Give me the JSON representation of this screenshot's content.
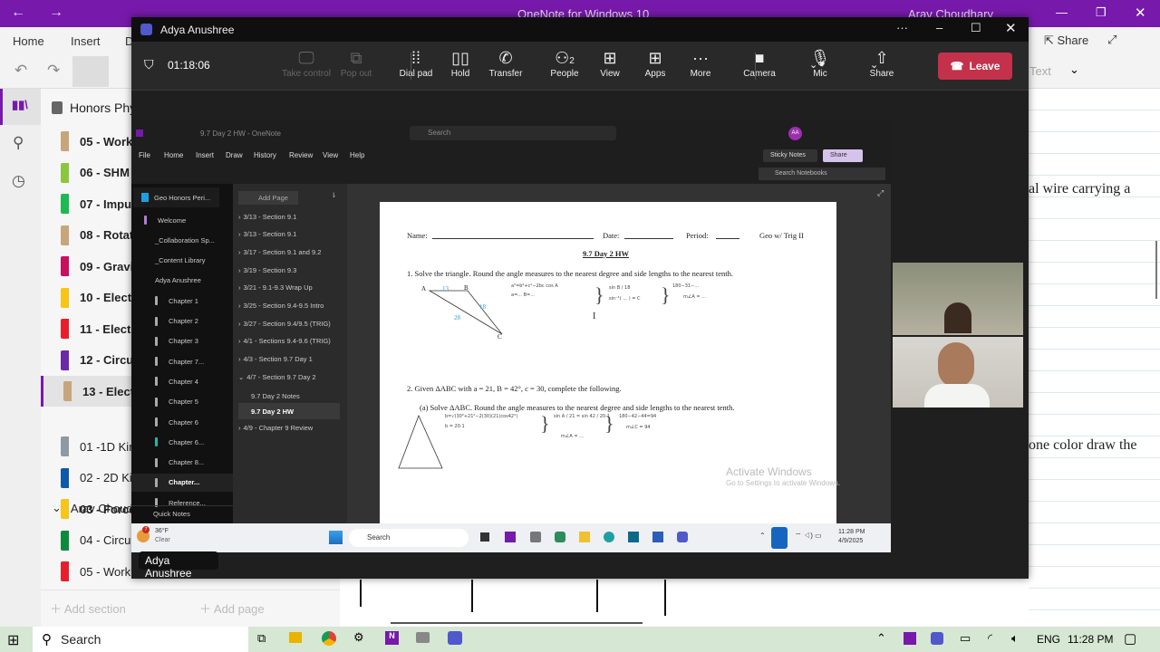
{
  "onenote": {
    "title": "OneNote for Windows 10",
    "user": "Arav Choudhary",
    "tabs": [
      "Home",
      "Insert",
      "D"
    ],
    "share_label": "Share",
    "text_label": "Text",
    "notebook": "Honors Phys",
    "sections": [
      {
        "label": "05 - Work",
        "color": "#c8a57a"
      },
      {
        "label": "06 - SHM",
        "color": "#8cc63f"
      },
      {
        "label": "07 - Impul",
        "color": "#1db954"
      },
      {
        "label": "08 - Rotati",
        "color": "#c8a57a"
      },
      {
        "label": "09 - Gravit",
        "color": "#c8105e"
      },
      {
        "label": "10 - Electri",
        "color": "#f5c518"
      },
      {
        "label": "11 - Electri",
        "color": "#e81e2c"
      },
      {
        "label": "12 - Circuit",
        "color": "#6b2aa8"
      },
      {
        "label": "13 - Electro",
        "color": "#c8a57a"
      }
    ],
    "group": "Arav Choud",
    "group_sections": [
      {
        "label": "01 -1D Kin",
        "color": "#8e9aa3"
      },
      {
        "label": "02 - 2D Kin",
        "color": "#0f5aa8"
      },
      {
        "label": "03 - Force",
        "color": "#f5c518"
      },
      {
        "label": "04 - Circula",
        "color": "#0e8a3e"
      },
      {
        "label": "05 - Work",
        "color": "#e81e2c"
      }
    ],
    "add_section": "Add section",
    "add_page": "Add page",
    "note_lines": [
      "al wire carrying a",
      "one color draw the"
    ]
  },
  "teams": {
    "title": "Adya Anushree",
    "timer": "01:18:06",
    "buttons": [
      {
        "label": "Take control",
        "icon": "monitor-cursor"
      },
      {
        "label": "Pop out",
        "icon": "popout"
      },
      {
        "label": "Dial pad",
        "icon": "dialpad"
      },
      {
        "label": "Hold",
        "icon": "pause"
      },
      {
        "label": "Transfer",
        "icon": "phone-transfer"
      },
      {
        "label": "People",
        "icon": "people",
        "count": "2"
      },
      {
        "label": "View",
        "icon": "grid"
      },
      {
        "label": "Apps",
        "icon": "plus-box"
      },
      {
        "label": "More",
        "icon": "ellipsis"
      },
      {
        "label": "Camera",
        "icon": "camera"
      },
      {
        "label": "Mic",
        "icon": "mic"
      },
      {
        "label": "Share",
        "icon": "share-up"
      }
    ],
    "leave_label": "Leave",
    "leave_color": "#c4314b",
    "presenter_label": "Adya Anushree"
  },
  "shared": {
    "title": "9.7 Day 2 HW  -  OneNote",
    "search": "Search",
    "avatar": "AA",
    "menu": [
      "File",
      "Home",
      "Insert",
      "Draw",
      "History",
      "Review",
      "View",
      "Help"
    ],
    "sticky": "Sticky Notes",
    "share": "Share",
    "search_notebooks": "Search Notebooks",
    "notebook": "Geo Honors Peri...",
    "sections": [
      "Welcome",
      "_Collaboration Sp...",
      "_Content Library",
      "Adya Anushree",
      "Chapter 1",
      "Chapter 2",
      "Chapter 3",
      "Chapter 7...",
      "Chapter 4",
      "Chapter 5",
      "Chapter 6",
      "Chapter 6...",
      "Chapter 8...",
      "Chapter...",
      "Reference..."
    ],
    "quick_notes": "Quick Notes",
    "add_page": "Add Page",
    "pages": [
      "3/13 - Section 9.1",
      "3/13 - Section 9.1",
      "3/17 - Section 9.1 and 9.2",
      "3/19 - Section 9.3",
      "3/21 - 9.1-9.3 Wrap Up",
      "3/25 - Section 9.4-9.5 Intro",
      "3/27 - Section 9.4/9.5 (TRIG)",
      "4/1 - Sections 9.4-9.6 (TRIG)",
      "4/3 - Section 9.7 Day 1",
      "4/7 - Section 9.7 Day 2"
    ],
    "subpages": [
      "9.7 Day 2 Notes",
      "9.7 Day 2 HW"
    ],
    "last_page": "4/9 - Chapter 9 Review",
    "doc": {
      "name": "Name:",
      "date": "Date:",
      "period": "Period:",
      "course": "Geo w/ Trig II",
      "title": "9.7 Day 2 HW",
      "q1": "1.   Solve the triangle. Round the angle measures to the nearest degree and side lengths to the nearest tenth.",
      "q1_labels": {
        "a": "A",
        "b": "B",
        "c": "C",
        "ab": "13",
        "bc": "18",
        "ac": "28"
      },
      "q2": "2.   Given ΔABC with a = 21, B = 42°, c = 30, complete the following.",
      "q2a": "(a)  Solve ΔABC. Round the angle measures to the nearest degree and side lengths to the nearest tenth."
    },
    "activate_title": "Activate Windows",
    "activate_sub": "Go to Settings to activate Windows.",
    "weather_temp": "36°F",
    "weather_desc": "Clear",
    "weather_badge": "7",
    "task_search": "Search",
    "time": "11:28 PM",
    "date": "4/9/2025"
  },
  "taskbar": {
    "search": "Search",
    "lang": "ENG",
    "time": "11:28 PM"
  }
}
